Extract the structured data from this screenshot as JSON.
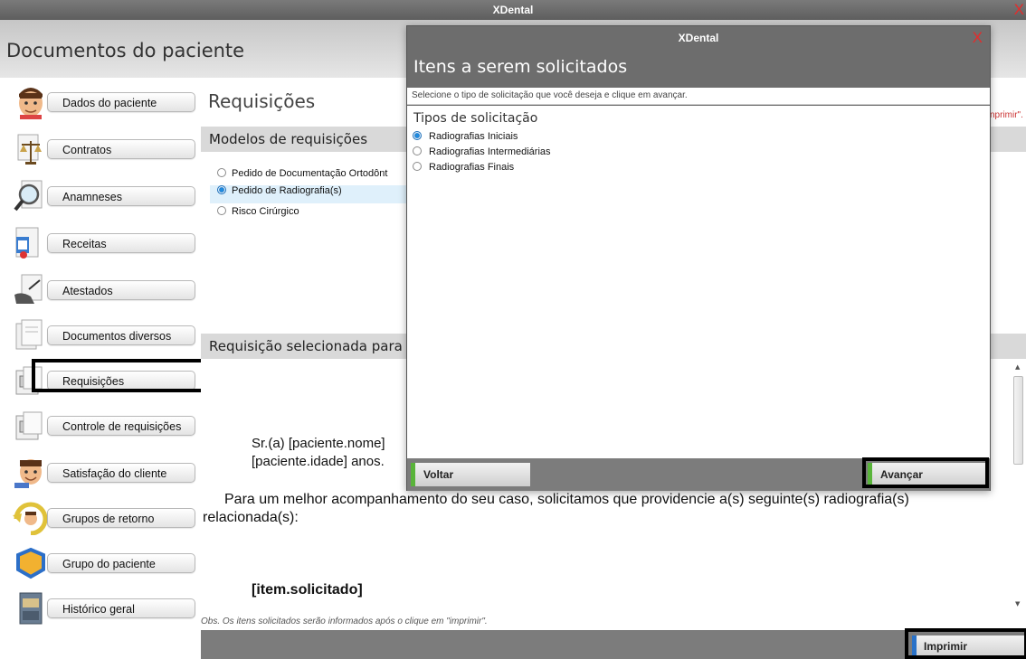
{
  "window": {
    "title": "XDental",
    "close_glyph": "X"
  },
  "header": {
    "title": "Documentos do paciente"
  },
  "sidebar": {
    "items": [
      {
        "label": "Dados do paciente",
        "icon": "patient-face-icon"
      },
      {
        "label": "Contratos",
        "icon": "scales-document-icon"
      },
      {
        "label": "Anamneses",
        "icon": "magnifier-icon"
      },
      {
        "label": "Receitas",
        "icon": "prescription-icon"
      },
      {
        "label": "Atestados",
        "icon": "certificate-icon"
      },
      {
        "label": "Documentos diversos",
        "icon": "documents-icon"
      },
      {
        "label": "Requisições",
        "icon": "requisition-icon",
        "selected": true
      },
      {
        "label": "Controle de requisições",
        "icon": "requisition-control-icon"
      },
      {
        "label": "Satisfação do cliente",
        "icon": "satisfaction-icon"
      },
      {
        "label": "Grupos de retorno",
        "icon": "return-group-icon"
      },
      {
        "label": "Grupo do paciente",
        "icon": "patient-group-icon"
      },
      {
        "label": "Histórico geral",
        "icon": "history-cabinet-icon"
      }
    ]
  },
  "main": {
    "section_title": "Requisições",
    "models_header": "Modelos de requisições",
    "models": [
      {
        "label": "Pedido de Documentação Ortodônt",
        "selected": false
      },
      {
        "label": "Pedido de Radiografia(s)",
        "selected": true
      },
      {
        "label": "Risco Cirúrgico",
        "selected": false
      }
    ],
    "selected_header": "Requisição selecionada para",
    "doc": {
      "line1": "Sr.(a) [paciente.nome]",
      "line2": "[paciente.idade] anos.",
      "paragraph_1": "Para um melhor acompanhamento do seu caso, solicitamos que providencie a(s) seguinte(s) radiografia(s)",
      "paragraph_2": "relacionada(s):",
      "item_placeholder": "[item.solicitado]"
    },
    "obs": "Obs. Os itens solicitados serão informados após o clique em \"imprimir\".",
    "obs_partial_right": "nprimir\".",
    "print_label": "Imprimir"
  },
  "modal": {
    "title": "XDental",
    "heading": "Itens a serem solicitados",
    "instruction": "Selecione o tipo de solicitação que você deseja e clique em avançar.",
    "types_label": "Tipos de solicitação",
    "options": [
      {
        "label": "Radiografias  Iniciais",
        "selected": true
      },
      {
        "label": "Radiografias  Intermediárias",
        "selected": false
      },
      {
        "label": "Radiografias Finais",
        "selected": false
      }
    ],
    "back_label": "Voltar",
    "next_label": "Avançar"
  },
  "colors": {
    "accent_blue": "#1f6fb8",
    "button_green": "#59b43a",
    "close_red": "#e52b2b",
    "bar_gray": "#7c7c7c"
  }
}
